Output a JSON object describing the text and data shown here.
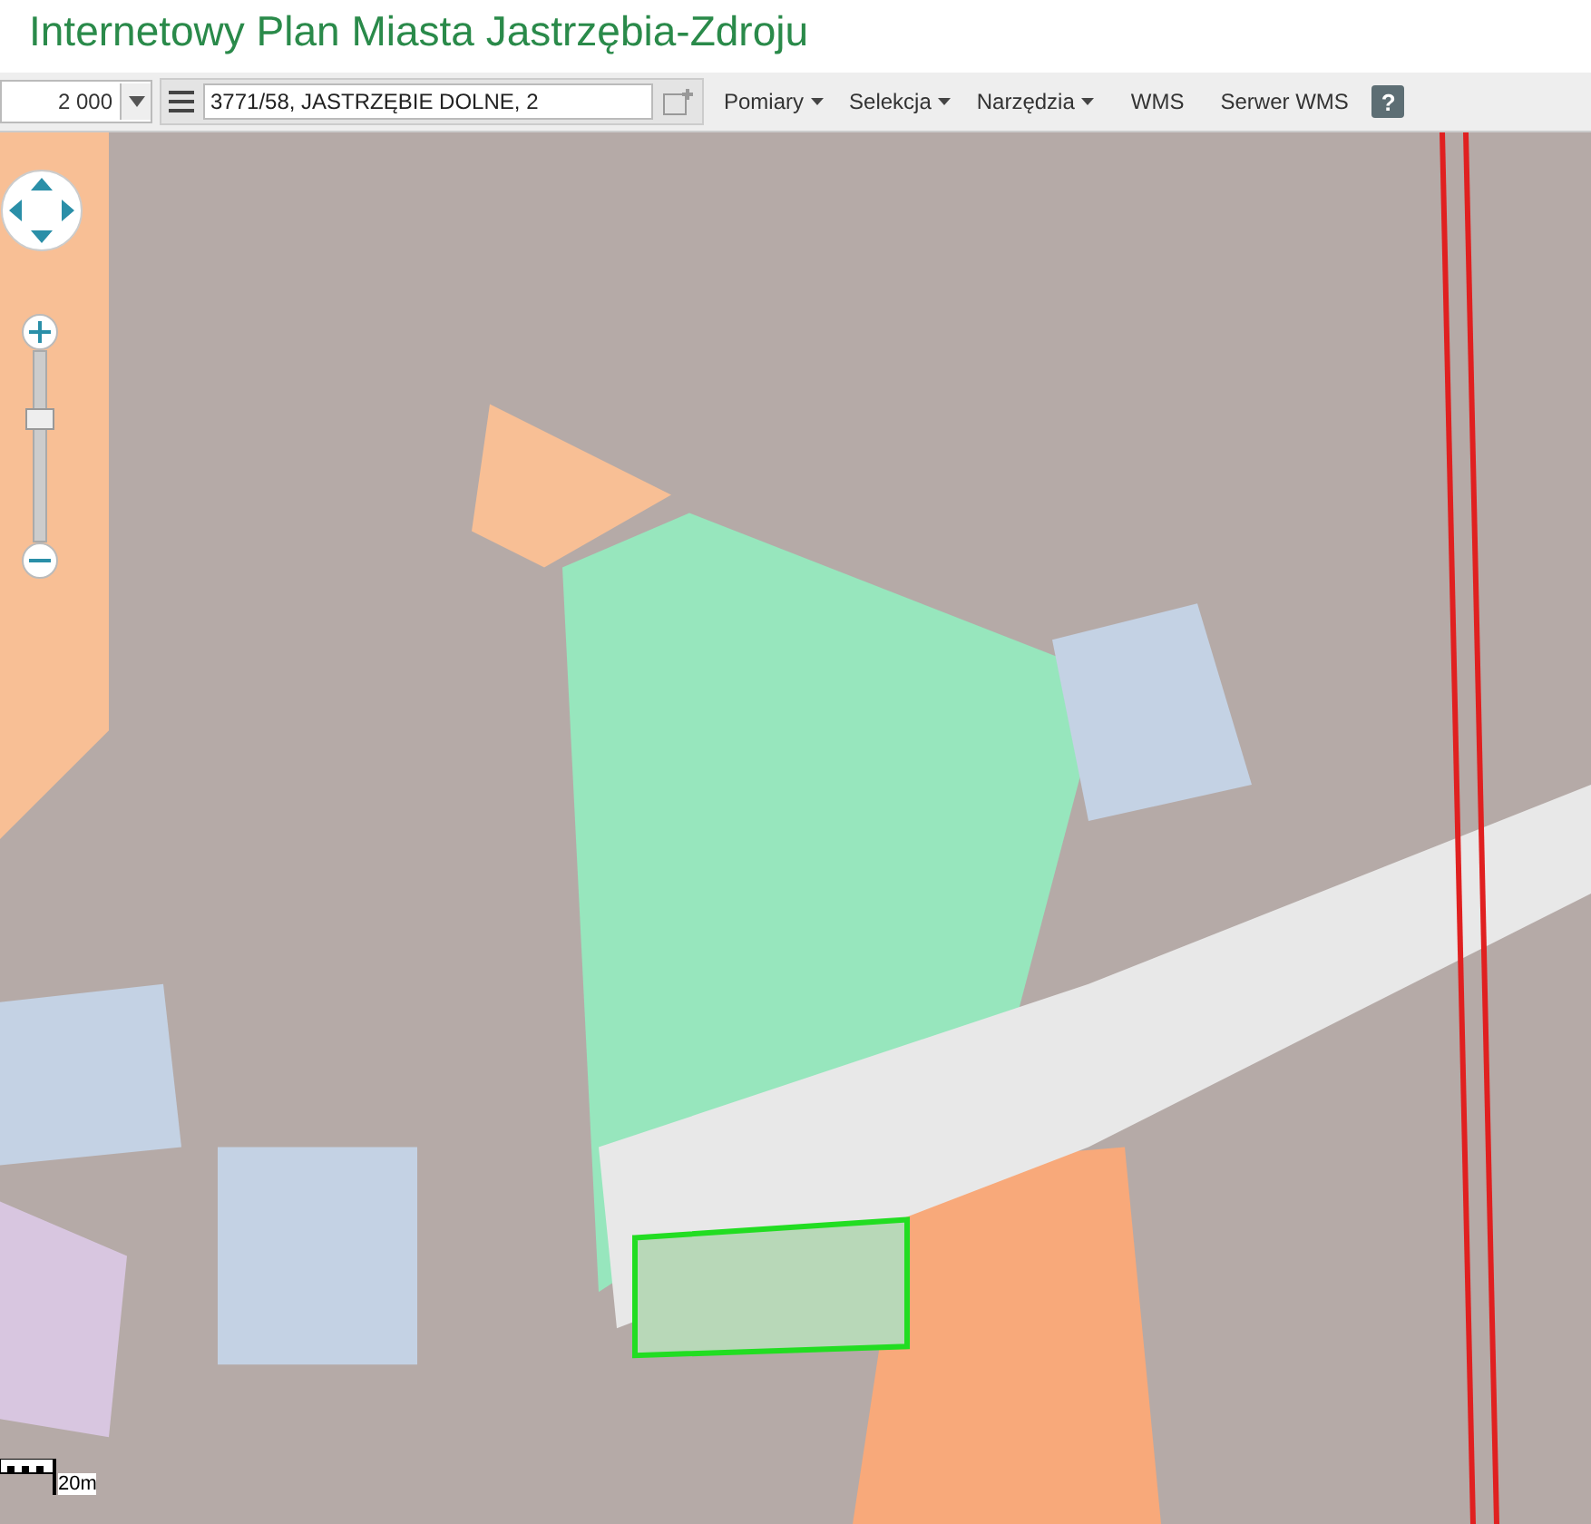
{
  "title": "Internetowy Plan Miasta Jastrzębia-Zdroju",
  "toolbar": {
    "scale": "2 000",
    "search": {
      "value": "3771/58, JASTRZĘBIE DOLNE, 2"
    },
    "menus": [
      {
        "label": "Pomiary",
        "kind": "dropdown"
      },
      {
        "label": "Selekcja",
        "kind": "dropdown"
      },
      {
        "label": "Narzędzia",
        "kind": "dropdown"
      },
      {
        "label": "WMS",
        "kind": "link"
      },
      {
        "label": "Serwer WMS",
        "kind": "link"
      }
    ],
    "help": "?"
  },
  "map": {
    "zoom_slider": {
      "level": 0.63
    },
    "scale_bar": {
      "label": "20m"
    }
  }
}
